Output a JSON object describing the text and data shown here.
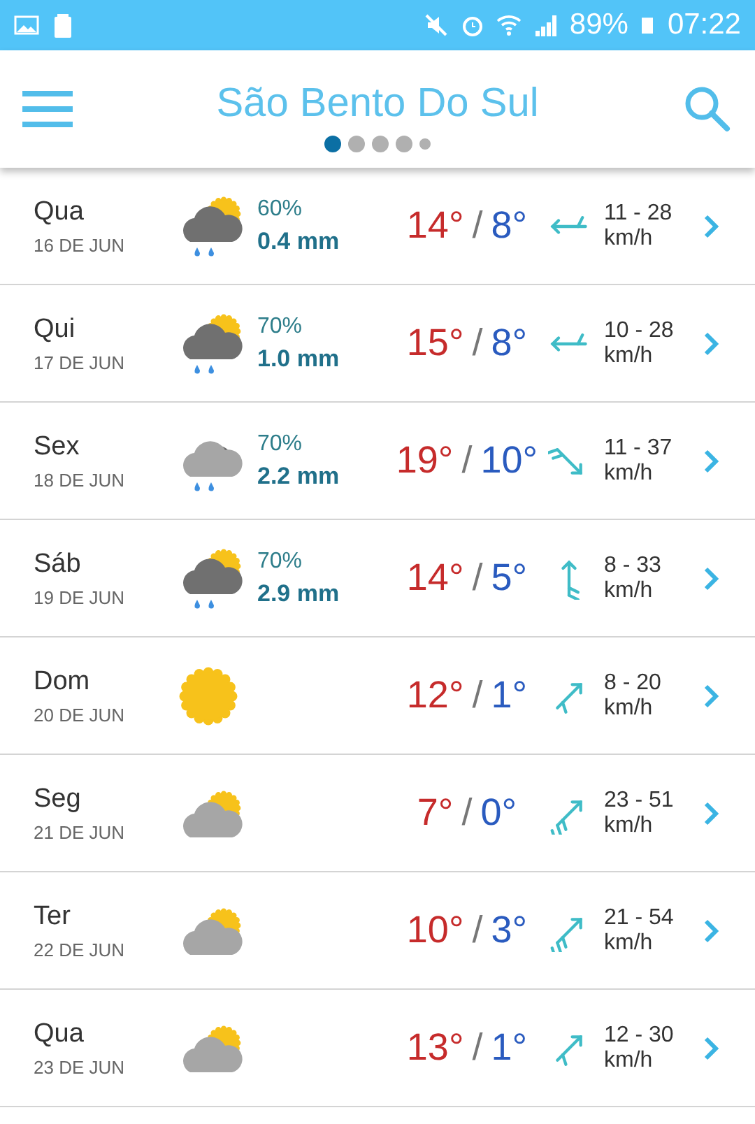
{
  "status_bar": {
    "battery": "89%",
    "time": "07:22"
  },
  "header": {
    "title": "São Bento Do Sul",
    "pages": [
      {
        "kind": "page",
        "selected": true
      },
      {
        "kind": "page",
        "selected": false
      },
      {
        "kind": "page",
        "selected": false
      },
      {
        "kind": "page",
        "selected": false
      },
      {
        "kind": "more",
        "selected": false
      }
    ]
  },
  "days": [
    {
      "day": "Qua",
      "date": "16 DE JUN",
      "kind": "rainsun",
      "chance": "60%",
      "rain": "0.4 mm",
      "high": "14°",
      "separator": "/",
      "low": "8°",
      "wind_arrow": {
        "kind": "west",
        "barbs": {
          "kind": "single"
        }
      },
      "wind": "11 - 28",
      "unit": "km/h"
    },
    {
      "day": "Qui",
      "date": "17 DE JUN",
      "kind": "rainsun",
      "chance": "70%",
      "rain": "1.0 mm",
      "high": "15°",
      "separator": "/",
      "low": "8°",
      "wind_arrow": {
        "kind": "west",
        "barbs": {
          "kind": "single"
        }
      },
      "wind": "10 - 28",
      "unit": "km/h"
    },
    {
      "day": "Sex",
      "date": "18 DE JUN",
      "kind": "raincloud",
      "chance": "70%",
      "rain": "2.2 mm",
      "high": "19°",
      "separator": "/",
      "low": "10°",
      "wind_arrow": {
        "kind": "southeast",
        "barbs": {
          "kind": "double"
        }
      },
      "wind": "11 - 37",
      "unit": "km/h"
    },
    {
      "day": "Sáb",
      "date": "19 DE JUN",
      "kind": "rainsun",
      "chance": "70%",
      "rain": "2.9 mm",
      "high": "14°",
      "separator": "/",
      "low": "5°",
      "wind_arrow": {
        "kind": "north",
        "barbs": {
          "kind": "double"
        }
      },
      "wind": "8 - 33",
      "unit": "km/h"
    },
    {
      "day": "Dom",
      "date": "20 DE JUN",
      "kind": "sun",
      "high": "12°",
      "separator": "/",
      "low": "1°",
      "wind_arrow": {
        "kind": "northeast",
        "barbs": {
          "kind": "single"
        }
      },
      "wind": "8 - 20",
      "unit": "km/h"
    },
    {
      "day": "Seg",
      "date": "21 DE JUN",
      "kind": "cloudsun",
      "high": "7°",
      "separator": "/",
      "low": "0°",
      "wind_arrow": {
        "kind": "northeast",
        "barbs": {
          "kind": "triple"
        }
      },
      "wind": "23 - 51",
      "unit": "km/h"
    },
    {
      "day": "Ter",
      "date": "22 DE JUN",
      "kind": "cloudsun",
      "high": "10°",
      "separator": "/",
      "low": "3°",
      "wind_arrow": {
        "kind": "northeast",
        "barbs": {
          "kind": "triple"
        }
      },
      "wind": "21 - 54",
      "unit": "km/h"
    },
    {
      "day": "Qua",
      "date": "23 DE JUN",
      "kind": "cloudsun",
      "high": "13°",
      "separator": "/",
      "low": "1°",
      "wind_arrow": {
        "kind": "northeast",
        "barbs": {
          "kind": "single"
        }
      },
      "wind": "12 - 30",
      "unit": "km/h"
    }
  ]
}
